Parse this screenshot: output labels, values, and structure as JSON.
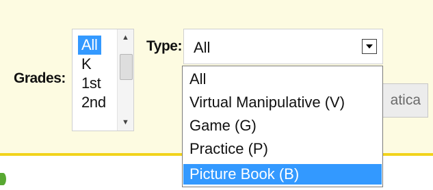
{
  "colors": {
    "panel_bg": "#fdfbe1",
    "rule": "#f2d31b",
    "selection": "#3399ff"
  },
  "grades": {
    "label": "Grades:",
    "options": [
      "All",
      "K",
      "1st",
      "2nd"
    ],
    "selected": "All"
  },
  "type": {
    "label": "Type:",
    "value": "All",
    "options": [
      {
        "label": "All"
      },
      {
        "label": "Virtual Manipulative (V)"
      },
      {
        "label": "Game (G)"
      },
      {
        "label": "Practice (P)"
      },
      {
        "label": "Picture Book (B)",
        "highlighted": true
      }
    ]
  },
  "partial_button": {
    "label": "atica"
  }
}
